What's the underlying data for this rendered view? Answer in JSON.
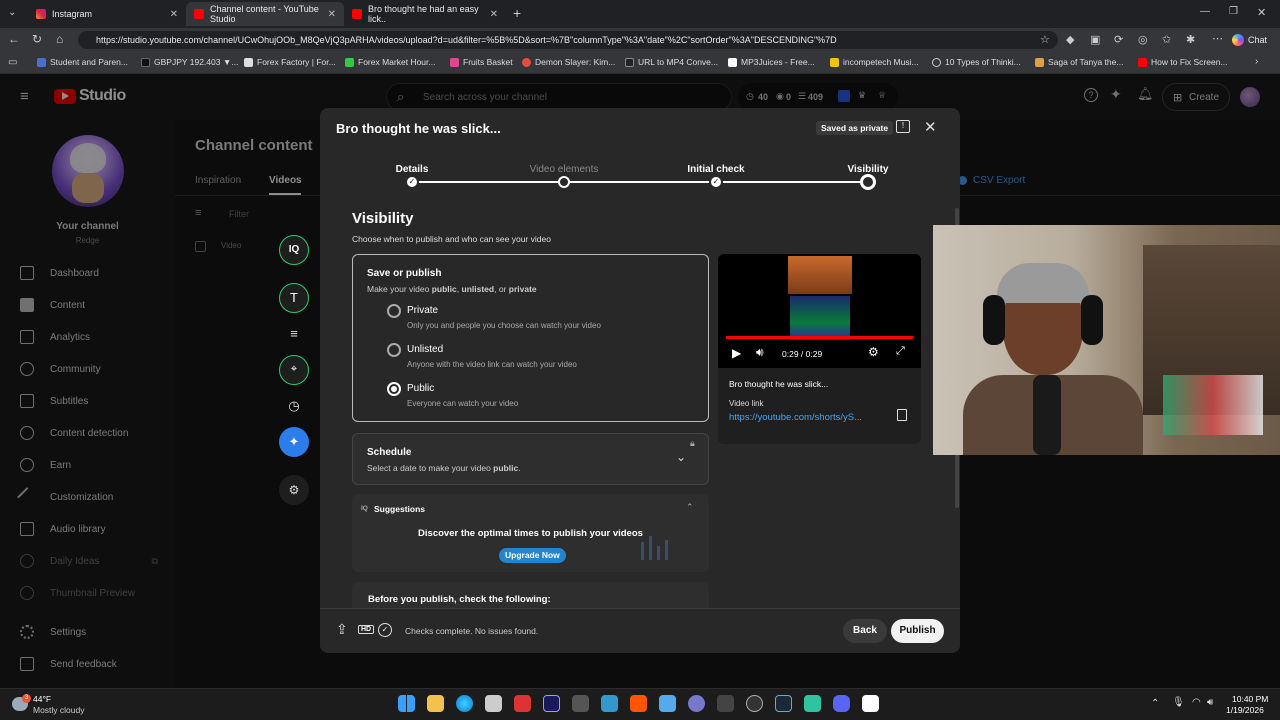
{
  "browser": {
    "tabs": [
      {
        "label": "Instagram"
      },
      {
        "label": "Channel content - YouTube Studio"
      },
      {
        "label": "Bro thought he had an easy lick.."
      }
    ],
    "url": "https://studio.youtube.com/channel/UCwOhujOOb_M8QeVjQ3pARHA/videos/upload?d=ud&filter=%5B%5D&sort=%7B\"columnType\"%3A\"date\"%2C\"sortOrder\"%3A\"DESCENDING\"%7D",
    "bookmarks": [
      {
        "label": "Student and Paren..."
      },
      {
        "label": "GBPJPY 192.403 ▼..."
      },
      {
        "label": "Forex Factory | For..."
      },
      {
        "label": "Forex Market Hour..."
      },
      {
        "label": "Fruits Basket"
      },
      {
        "label": "Demon Slayer: Kim..."
      },
      {
        "label": "URL to MP4 Conve..."
      },
      {
        "label": "MP3Juices - Free..."
      },
      {
        "label": "incompetech Musi..."
      },
      {
        "label": "10 Types of Thinki..."
      },
      {
        "label": "Saga of Tanya the..."
      },
      {
        "label": "How to Fix Screen..."
      }
    ],
    "chat_label": "Chat"
  },
  "studio": {
    "logo": "Studio",
    "search_placeholder": "Search across your channel",
    "stats": [
      "40",
      "0",
      "409"
    ],
    "create_label": "Create",
    "channel_label": "Your channel",
    "channel_name": "Redge",
    "page_title": "Channel content",
    "tabs": [
      "Inspiration",
      "Videos"
    ],
    "filter_label": "Filter",
    "video_col": "Video",
    "csv_export": "CSV Export",
    "sidebar": [
      {
        "label": "Dashboard"
      },
      {
        "label": "Content"
      },
      {
        "label": "Analytics"
      },
      {
        "label": "Community"
      },
      {
        "label": "Subtitles"
      },
      {
        "label": "Content detection"
      },
      {
        "label": "Earn"
      },
      {
        "label": "Customization"
      },
      {
        "label": "Audio library"
      },
      {
        "label": "Daily Ideas"
      },
      {
        "label": "Thumbnail Preview"
      }
    ],
    "settings_label": "Settings",
    "feedback_label": "Send feedback"
  },
  "dialog": {
    "title": "Bro thought he was slick...",
    "saved_badge": "Saved as private",
    "steps": [
      "Details",
      "Video elements",
      "Initial check",
      "Visibility"
    ],
    "heading": "Visibility",
    "subheading": "Choose when to publish and who can see your video",
    "save_publish": {
      "title": "Save or publish",
      "desc_pre": "Make your video ",
      "desc_public": "public",
      "desc_sep1": ", ",
      "desc_unlisted": "unlisted",
      "desc_sep2": ", or ",
      "desc_private": "private",
      "options": [
        {
          "label": "Private",
          "desc": "Only you and people you choose can watch your video"
        },
        {
          "label": "Unlisted",
          "desc": "Anyone with the video link can watch your video"
        },
        {
          "label": "Public",
          "desc": "Everyone can watch your video"
        }
      ]
    },
    "schedule": {
      "title": "Schedule",
      "desc_pre": "Select a date to make your video ",
      "desc_bold": "public",
      "desc_post": "."
    },
    "suggestions": {
      "badge": "IQ",
      "title": "Suggestions",
      "text": "Discover the optimal times to publish your videos",
      "upgrade": "Upgrade Now"
    },
    "before_publish": "Before you publish, check the following:",
    "preview": {
      "time": "0:29 / 0:29",
      "title": "Bro thought he was slick...",
      "link_label": "Video link",
      "link": "https://youtube.com/shorts/yS..."
    },
    "footer": {
      "status": "Checks complete. No issues found.",
      "hd": "HD",
      "back": "Back",
      "publish": "Publish"
    }
  },
  "taskbar": {
    "weather_temp": "44°F",
    "weather_desc": "Mostly cloudy",
    "time": "10:40 PM",
    "date": "1/19/2026",
    "notif_count": "3"
  },
  "colors": {
    "accent_blue": "#3ea6ff",
    "yt_red": "#ff0000",
    "dialog_bg": "#282828",
    "upgrade_blue": "#2185d0"
  }
}
